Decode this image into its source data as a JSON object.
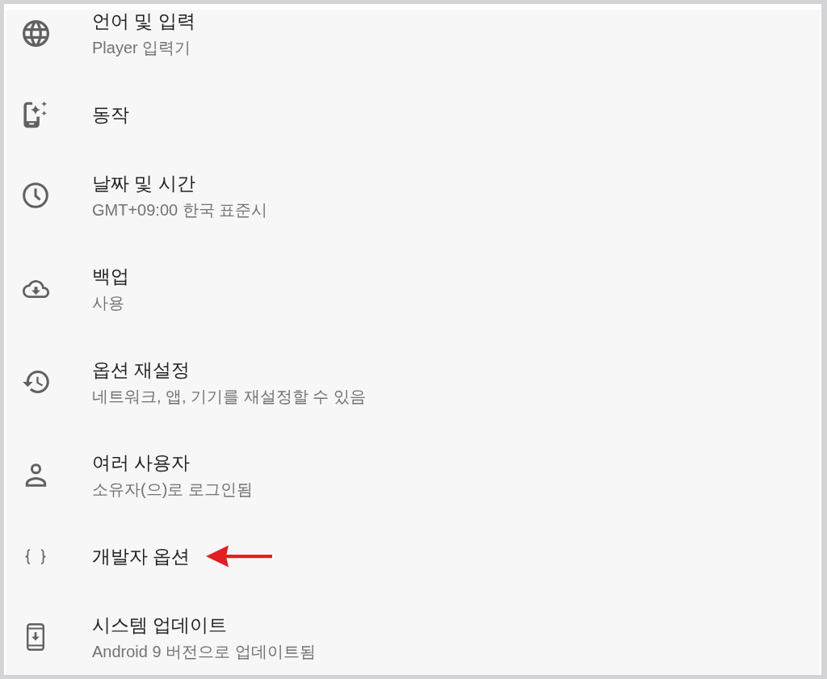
{
  "settings": {
    "items": [
      {
        "title": "언어 및 입력",
        "subtitle": "Player 입력기",
        "marked": false
      },
      {
        "title": "동작",
        "marked": false
      },
      {
        "title": "날짜 및 시간",
        "subtitle": "GMT+09:00 한국 표준시",
        "marked": false
      },
      {
        "title": "백업",
        "subtitle": "사용",
        "marked": false
      },
      {
        "title": "옵션 재설정",
        "subtitle": "네트워크, 앱, 기기를 재설정할 수 있음",
        "marked": false
      },
      {
        "title": "여러 사용자",
        "subtitle": "소유자(으)로 로그인됨",
        "marked": false
      },
      {
        "title": "개발자 옵션",
        "marked": true
      },
      {
        "title": "시스템 업데이트",
        "subtitle": "Android 9 버전으로 업데이트됨",
        "marked": false
      }
    ]
  }
}
